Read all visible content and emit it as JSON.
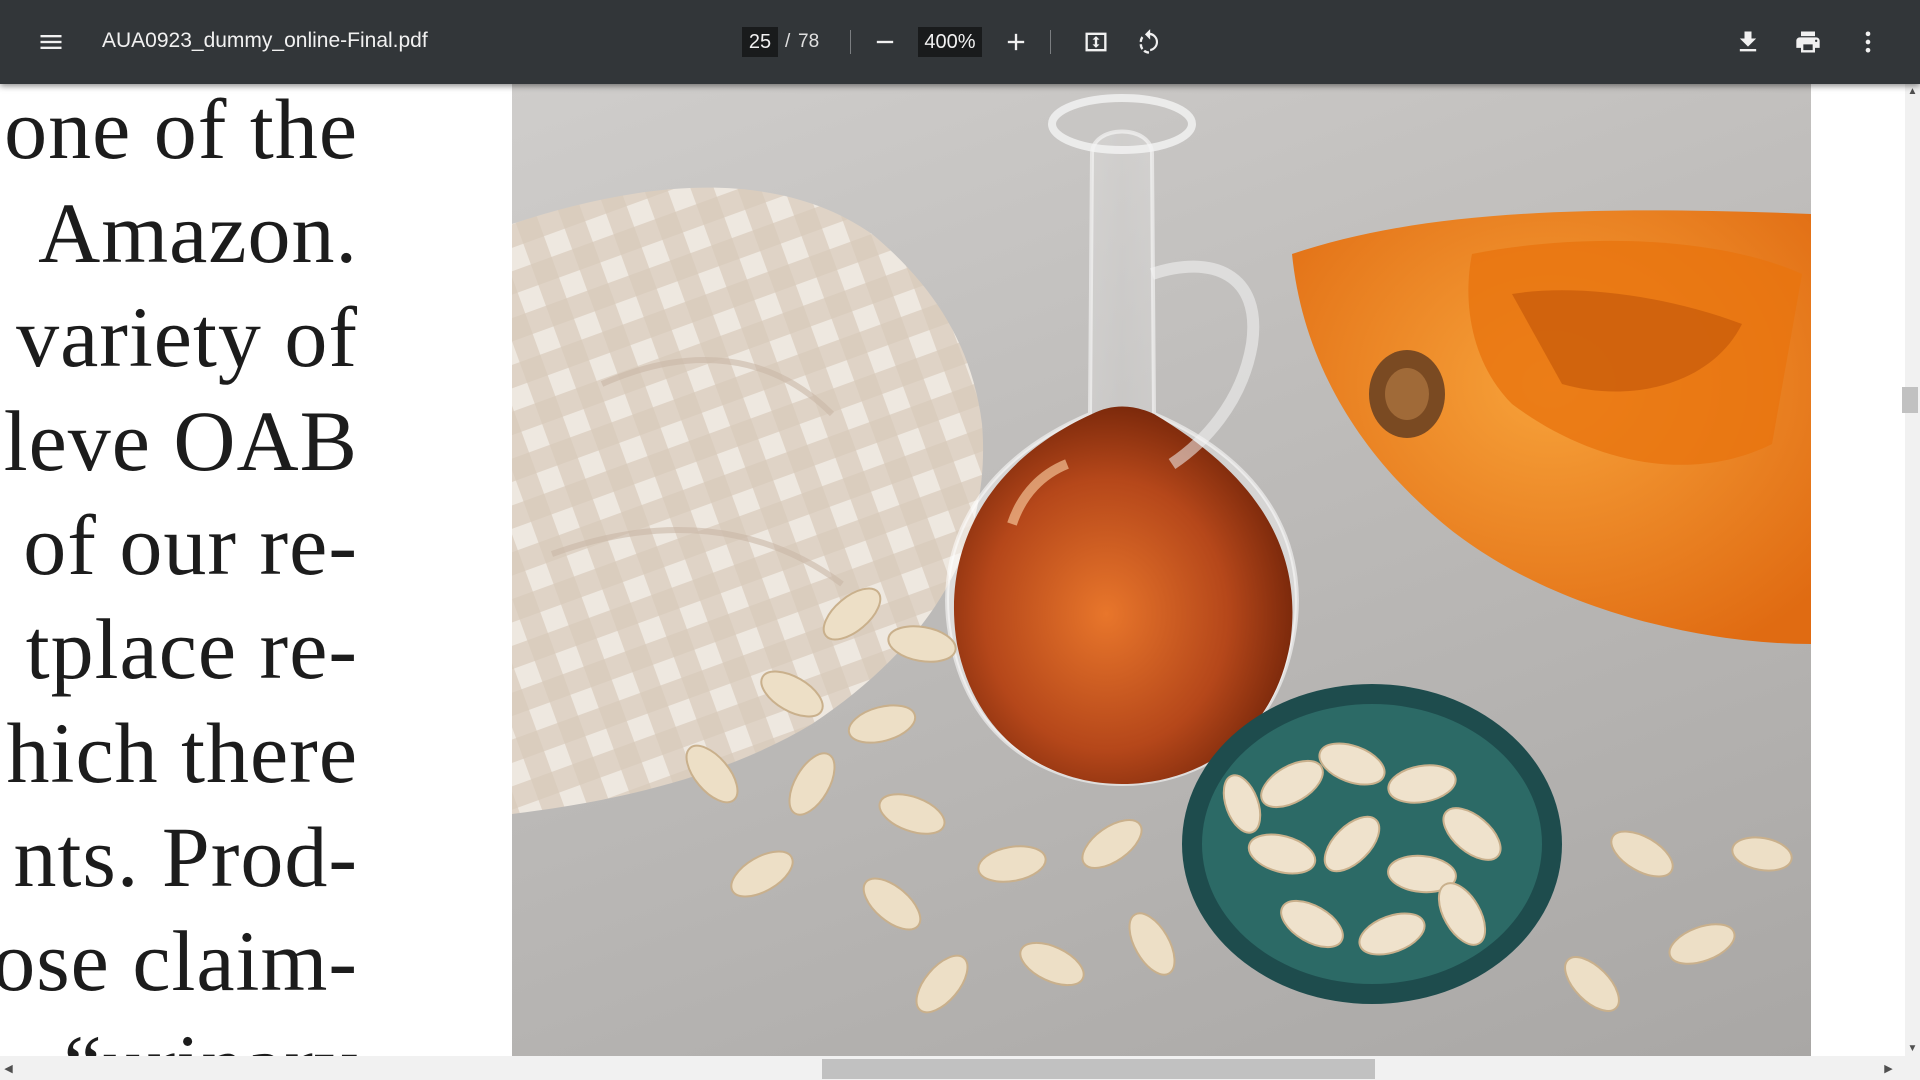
{
  "toolbar": {
    "menu_icon": "hamburger-menu-icon",
    "file_name": "AUA0923_dummy_online-Final.pdf",
    "current_page": "25",
    "page_separator": "/",
    "total_pages": "78",
    "zoom": "400%",
    "icons": {
      "zoom_out": "minus-icon",
      "zoom_in": "plus-icon",
      "fit": "fit-to-page-icon",
      "rotate": "rotate-counterclockwise-icon",
      "download": "download-icon",
      "print": "print-icon",
      "more": "more-vertical-icon"
    }
  },
  "document": {
    "text_lines": [
      "one of the",
      "Amazon.",
      "variety  of",
      "leve OAB",
      "of  our  re-",
      "tplace re-",
      "hich there",
      "nts. Prod-",
      "ose  claim-",
      "“urinary"
    ]
  },
  "colors": {
    "toolbar_bg": "#323639",
    "viewer_bg": "#525659",
    "page_bg": "#ffffff",
    "oil": "#b5471a",
    "pumpkin": "#f28a22",
    "bowl": "#1e4c4d"
  }
}
